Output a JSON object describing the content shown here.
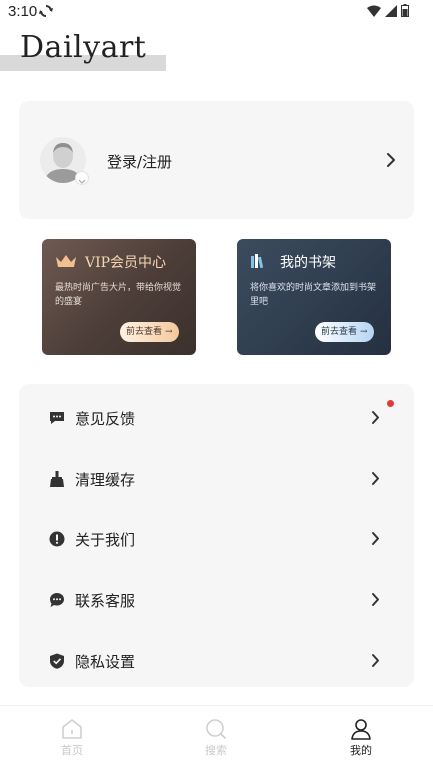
{
  "status_bar": {
    "time": "3:10",
    "sync_icon": "sync-icon",
    "wifi_icon": "wifi-icon",
    "signal_icon": "signal-icon",
    "battery_icon": "battery-icon"
  },
  "header": {
    "logo": "Dailyart"
  },
  "login": {
    "label": "登录/注册",
    "avatar_icon": "user-avatar-icon",
    "chevron_icon": "chevron-right-icon"
  },
  "cards": {
    "vip": {
      "title": "VIP会员中心",
      "description": "最热时尚广告大片，带给你视觉的盛宴",
      "button": "前去查看",
      "icon": "crown-icon",
      "accent": "#f5d7b3"
    },
    "shelf": {
      "title": "我的书架",
      "description": "将你喜欢的时尚文章添加到书架里吧",
      "button": "前去查看",
      "icon": "books-icon",
      "accent": "#b5d4f3"
    }
  },
  "menu": {
    "items": [
      {
        "label": "意见反馈",
        "icon": "feedback-icon",
        "has_badge": true
      },
      {
        "label": "清理缓存",
        "icon": "broom-icon",
        "has_badge": false
      },
      {
        "label": "关于我们",
        "icon": "info-icon",
        "has_badge": false
      },
      {
        "label": "联系客服",
        "icon": "chat-icon",
        "has_badge": false
      },
      {
        "label": "隐私设置",
        "icon": "shield-icon",
        "has_badge": false
      }
    ],
    "badge_color": "#e53935"
  },
  "bottom_nav": {
    "items": [
      {
        "label": "首页",
        "icon": "home-icon",
        "active": false
      },
      {
        "label": "搜索",
        "icon": "search-icon",
        "active": false
      },
      {
        "label": "我的",
        "icon": "profile-icon",
        "active": true
      }
    ]
  }
}
